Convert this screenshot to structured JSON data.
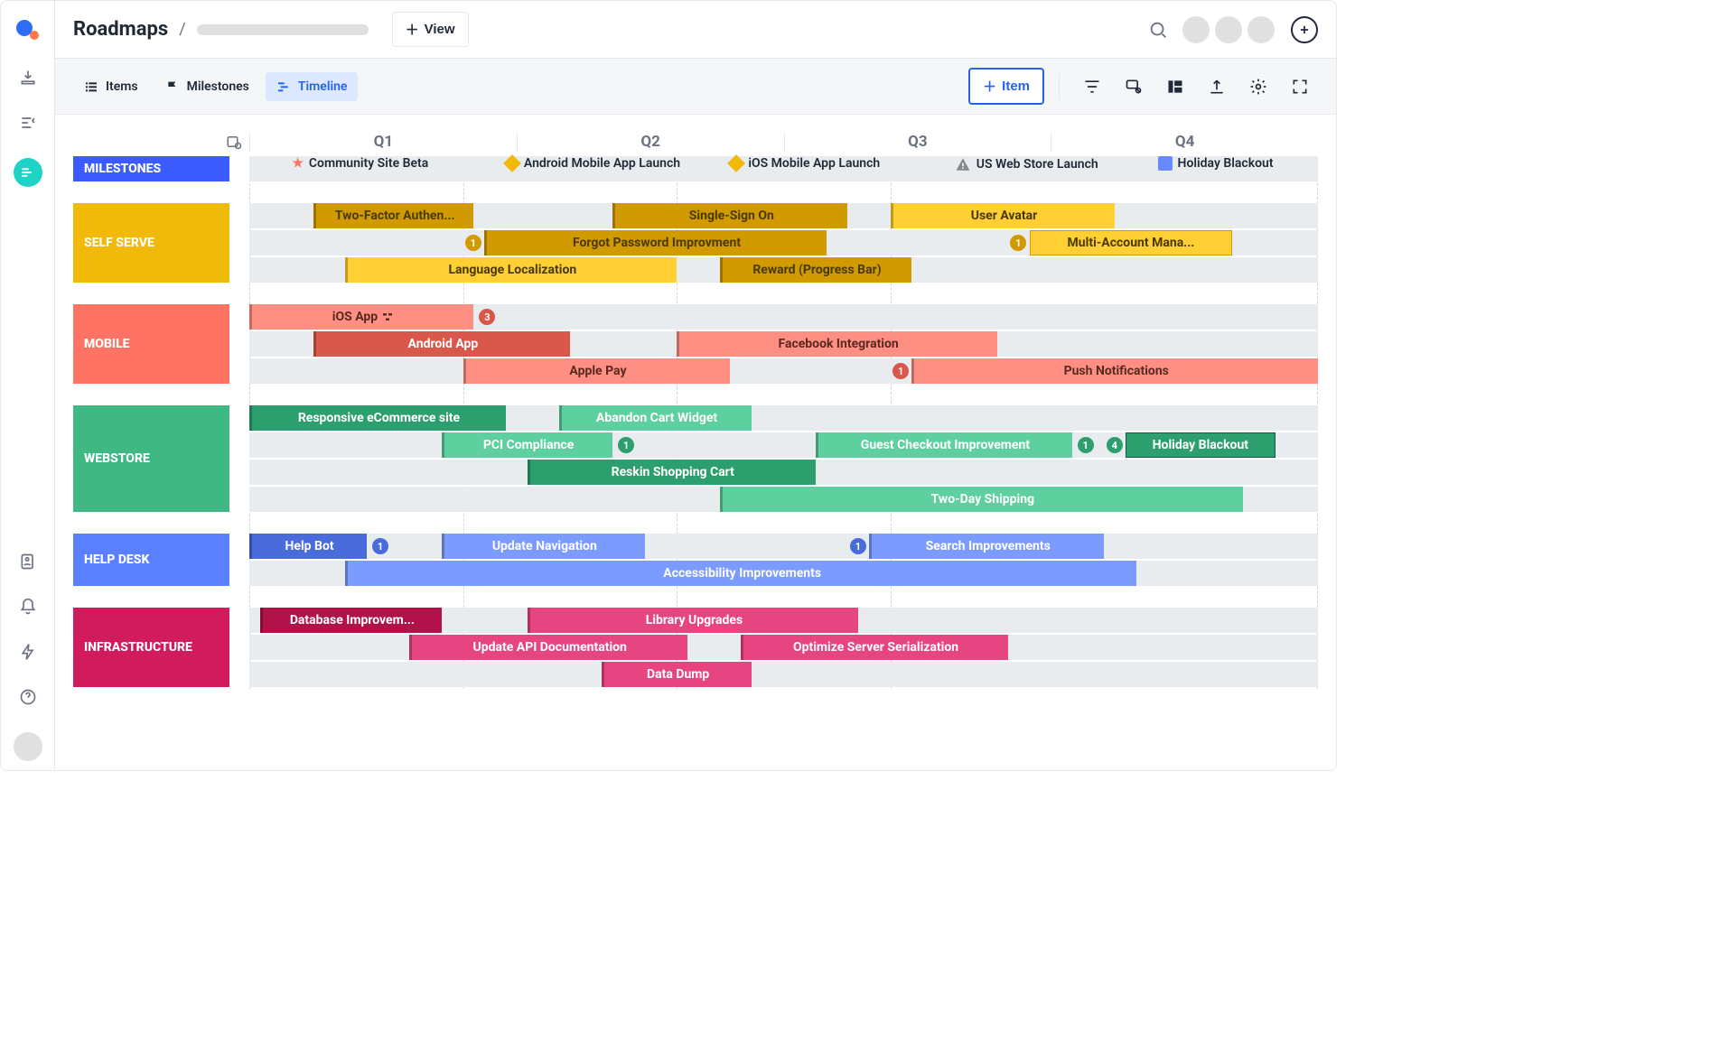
{
  "header": {
    "title": "Roadmaps",
    "view_button": "View"
  },
  "toolbar": {
    "items_tab": "Items",
    "milestones_tab": "Milestones",
    "timeline_tab": "Timeline",
    "add_item_button": "Item"
  },
  "axis": {
    "q1": "Q1",
    "q2": "Q2",
    "q3": "Q3",
    "q4": "Q4"
  },
  "lanes": {
    "milestones": {
      "title": "MILESTONES",
      "m1": "Community Site Beta",
      "m2": "Android Mobile App Launch",
      "m3": "iOS Mobile App Launch",
      "m4": "US Web Store Launch",
      "m5": "Holiday Blackout"
    },
    "self": {
      "title": "SELF SERVE",
      "r1_a": "Two-Factor Authen...",
      "r1_b": "Single-Sign On",
      "r1_c": "User Avatar",
      "r2_a": "Forgot Password Improvment",
      "r2_b": "Multi-Account Mana...",
      "r3_a": "Language Localization",
      "r3_b": "Reward (Progress Bar)",
      "badge1": "1",
      "badge2": "1"
    },
    "mobile": {
      "title": "MOBILE",
      "r1_a": "iOS App",
      "r2_a": "Android App",
      "r2_b": "Facebook Integration",
      "r3_a": "Apple Pay",
      "r3_b": "Push Notifications",
      "badge1": "3",
      "badge2": "1"
    },
    "web": {
      "title": "WEBSTORE",
      "r1_a": "Responsive eCommerce site",
      "r1_b": "Abandon Cart Widget",
      "r2_a": "PCI Compliance",
      "r2_b": "Guest Checkout Improvement",
      "r2_c": "Holiday Blackout",
      "r3_a": "Reskin Shopping Cart",
      "r4_a": "Two-Day Shipping",
      "badge1": "1",
      "badge2": "1",
      "badge3": "4"
    },
    "help": {
      "title": "HELP DESK",
      "r1_a": "Help Bot",
      "r1_b": "Update Navigation",
      "r1_c": "Search Improvements",
      "r2_a": "Accessibility Improvements",
      "badge1": "1",
      "badge2": "1"
    },
    "infra": {
      "title": "INFRASTRUCTURE",
      "r1_a": "Database Improvem...",
      "r1_b": "Library Upgrades",
      "r2_a": "Update API Documentation",
      "r2_b": "Optimize Server Serialization",
      "r3_a": "Data Dump"
    }
  },
  "chart_data": {
    "type": "gantt",
    "quarters": [
      "Q1",
      "Q2",
      "Q3",
      "Q4"
    ],
    "time_range_pct": [
      0,
      100
    ],
    "milestones": [
      {
        "label": "Community Site Beta",
        "at_pct": 6,
        "icon": "star"
      },
      {
        "label": "Android Mobile App Launch",
        "at_pct": 25,
        "icon": "diamond"
      },
      {
        "label": "iOS Mobile App Launch",
        "at_pct": 47,
        "icon": "diamond"
      },
      {
        "label": "US Web Store Launch",
        "at_pct": 68,
        "icon": "warning"
      },
      {
        "label": "Holiday Blackout",
        "at_pct": 86,
        "icon": "chip"
      }
    ],
    "swimlanes": [
      {
        "name": "SELF SERVE",
        "color": "#f1b90a",
        "rows": [
          [
            {
              "label": "Two-Factor Authen...",
              "start_pct": 6,
              "end_pct": 21,
              "shade": "dark"
            },
            {
              "label": "Single-Sign On",
              "start_pct": 34,
              "end_pct": 56,
              "shade": "dark"
            },
            {
              "label": "User Avatar",
              "start_pct": 60,
              "end_pct": 81,
              "shade": "light"
            }
          ],
          [
            {
              "label": "Forgot Password Improvment",
              "start_pct": 22,
              "end_pct": 54,
              "shade": "dark",
              "badge_before": 1
            },
            {
              "label": "Multi-Account Mana...",
              "start_pct": 73,
              "end_pct": 92,
              "shade": "light",
              "badge_before": 1
            }
          ],
          [
            {
              "label": "Language Localization",
              "start_pct": 9,
              "end_pct": 40,
              "shade": "light"
            },
            {
              "label": "Reward (Progress Bar)",
              "start_pct": 44,
              "end_pct": 62,
              "shade": "dark"
            }
          ]
        ]
      },
      {
        "name": "MOBILE",
        "color": "#ff7364",
        "rows": [
          [
            {
              "label": "iOS App",
              "start_pct": 0,
              "end_pct": 21,
              "shade": "light",
              "badge_after": 3
            }
          ],
          [
            {
              "label": "Android App",
              "start_pct": 6,
              "end_pct": 30,
              "shade": "dark"
            },
            {
              "label": "Facebook Integration",
              "start_pct": 40,
              "end_pct": 70,
              "shade": "light"
            }
          ],
          [
            {
              "label": "Apple Pay",
              "start_pct": 20,
              "end_pct": 45,
              "shade": "light"
            },
            {
              "label": "Push Notifications",
              "start_pct": 62,
              "end_pct": 100,
              "shade": "light",
              "badge_before": 1
            }
          ]
        ]
      },
      {
        "name": "WEBSTORE",
        "color": "#3fb884",
        "rows": [
          [
            {
              "label": "Responsive eCommerce site",
              "start_pct": 0,
              "end_pct": 24,
              "shade": "dark"
            },
            {
              "label": "Abandon Cart Widget",
              "start_pct": 29,
              "end_pct": 47,
              "shade": "light"
            }
          ],
          [
            {
              "label": "PCI Compliance",
              "start_pct": 18,
              "end_pct": 34,
              "shade": "light",
              "badge_after": 1
            },
            {
              "label": "Guest Checkout Improvement",
              "start_pct": 53,
              "end_pct": 77,
              "shade": "light",
              "badge_after": 1
            },
            {
              "label": "Holiday Blackout",
              "start_pct": 82,
              "end_pct": 94,
              "shade": "dark",
              "badge_before": 4
            }
          ],
          [
            {
              "label": "Reskin Shopping Cart",
              "start_pct": 26,
              "end_pct": 53,
              "shade": "dark"
            }
          ],
          [
            {
              "label": "Two-Day Shipping",
              "start_pct": 44,
              "end_pct": 93,
              "shade": "light"
            }
          ]
        ]
      },
      {
        "name": "HELP DESK",
        "color": "#5a80ff",
        "rows": [
          [
            {
              "label": "Help Bot",
              "start_pct": 0,
              "end_pct": 11,
              "shade": "dark",
              "badge_after": 1
            },
            {
              "label": "Update Navigation",
              "start_pct": 18,
              "end_pct": 37,
              "shade": "light"
            },
            {
              "label": "Search Improvements",
              "start_pct": 58,
              "end_pct": 80,
              "shade": "light",
              "badge_before": 1
            }
          ],
          [
            {
              "label": "Accessibility Improvements",
              "start_pct": 9,
              "end_pct": 83,
              "shade": "light"
            }
          ]
        ]
      },
      {
        "name": "INFRASTRUCTURE",
        "color": "#d21b5d",
        "rows": [
          [
            {
              "label": "Database Improvem...",
              "start_pct": 1,
              "end_pct": 18,
              "shade": "dark"
            },
            {
              "label": "Library Upgrades",
              "start_pct": 26,
              "end_pct": 57,
              "shade": "light"
            }
          ],
          [
            {
              "label": "Update API Documentation",
              "start_pct": 15,
              "end_pct": 41,
              "shade": "light"
            },
            {
              "label": "Optimize Server Serialization",
              "start_pct": 46,
              "end_pct": 71,
              "shade": "light"
            }
          ],
          [
            {
              "label": "Data Dump",
              "start_pct": 33,
              "end_pct": 47,
              "shade": "light"
            }
          ]
        ]
      }
    ],
    "dependencies": [
      {
        "from": "iOS App",
        "to": "Multi-Account Mana...",
        "style": "dashed"
      },
      {
        "from": "iOS App",
        "to": "Holiday Blackout",
        "style": "dashed"
      },
      {
        "from": "iOS App",
        "to": "Search Improvements",
        "style": "solid"
      }
    ]
  }
}
